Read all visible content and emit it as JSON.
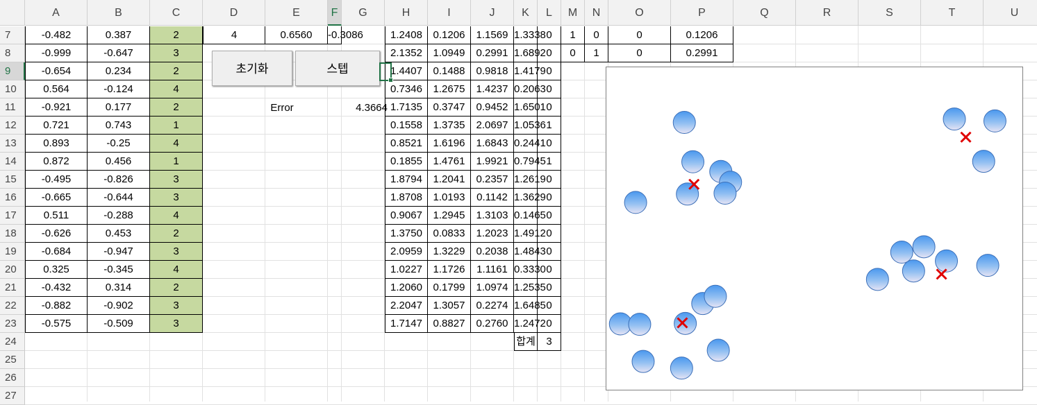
{
  "columns": [
    "A",
    "B",
    "C",
    "D",
    "E",
    "F",
    "G",
    "H",
    "I",
    "J",
    "K",
    "L",
    "M",
    "N",
    "O",
    "P",
    "Q",
    "R",
    "S",
    "T",
    "U"
  ],
  "rows": [
    "7",
    "8",
    "9",
    "10",
    "11",
    "12",
    "13",
    "14",
    "15",
    "16",
    "17",
    "18",
    "19",
    "20",
    "21",
    "22",
    "23",
    "24",
    "25",
    "26",
    "27"
  ],
  "selected_column": "F",
  "selected_row": "9",
  "table_abc": [
    [
      "-0.482",
      "0.387",
      "2"
    ],
    [
      "-0.999",
      "-0.647",
      "3"
    ],
    [
      "-0.654",
      "0.234",
      "2"
    ],
    [
      "0.564",
      "-0.124",
      "4"
    ],
    [
      "-0.921",
      "0.177",
      "2"
    ],
    [
      "0.721",
      "0.743",
      "1"
    ],
    [
      "0.893",
      "-0.25",
      "4"
    ],
    [
      "0.872",
      "0.456",
      "1"
    ],
    [
      "-0.495",
      "-0.826",
      "3"
    ],
    [
      "-0.665",
      "-0.644",
      "3"
    ],
    [
      "0.511",
      "-0.288",
      "4"
    ],
    [
      "-0.626",
      "0.453",
      "2"
    ],
    [
      "-0.684",
      "-0.947",
      "3"
    ],
    [
      "0.325",
      "-0.345",
      "4"
    ],
    [
      "-0.432",
      "0.314",
      "2"
    ],
    [
      "-0.882",
      "-0.902",
      "3"
    ],
    [
      "-0.575",
      "-0.509",
      "3"
    ]
  ],
  "table_def": [
    "4",
    "0.6560",
    "-0.3086"
  ],
  "buttons": {
    "init": "초기화",
    "step": "스텝"
  },
  "error": {
    "label": "Error",
    "value": "4.3664"
  },
  "table_hijkl": [
    [
      "1.2408",
      "0.1206",
      "1.1569",
      "1.3338",
      "0"
    ],
    [
      "2.1352",
      "1.0949",
      "0.2991",
      "1.6892",
      "0"
    ],
    [
      "1.4407",
      "0.1488",
      "0.9818",
      "1.4179",
      "0"
    ],
    [
      "0.7346",
      "1.2675",
      "1.4237",
      "0.2063",
      "0"
    ],
    [
      "1.7135",
      "0.3747",
      "0.9452",
      "1.6501",
      "0"
    ],
    [
      "0.1558",
      "1.3735",
      "2.0697",
      "1.0536",
      "1"
    ],
    [
      "0.8521",
      "1.6196",
      "1.6843",
      "0.2441",
      "0"
    ],
    [
      "0.1855",
      "1.4761",
      "1.9921",
      "0.7945",
      "1"
    ],
    [
      "1.8794",
      "1.2041",
      "0.2357",
      "1.2619",
      "0"
    ],
    [
      "1.8708",
      "1.0193",
      "0.1142",
      "1.3629",
      "0"
    ],
    [
      "0.9067",
      "1.2945",
      "1.3103",
      "0.1465",
      "0"
    ],
    [
      "1.3750",
      "0.0833",
      "1.2023",
      "1.4912",
      "0"
    ],
    [
      "2.0959",
      "1.3229",
      "0.2038",
      "1.4843",
      "0"
    ],
    [
      "1.0227",
      "1.1726",
      "1.1161",
      "0.3330",
      "0"
    ],
    [
      "1.2060",
      "0.1799",
      "1.0974",
      "1.2535",
      "0"
    ],
    [
      "2.2047",
      "1.3057",
      "0.2274",
      "1.6485",
      "0"
    ],
    [
      "1.7147",
      "0.8827",
      "0.2760",
      "1.2472",
      "0"
    ]
  ],
  "table_mnop": [
    [
      "1",
      "0",
      "0",
      "0.1206"
    ],
    [
      "0",
      "1",
      "0",
      "0.2991"
    ]
  ],
  "sum_row": {
    "label": "합계",
    "value": "3"
  },
  "colors": {
    "header_bg": "#f2f2f2",
    "green_cell": "#c6d9a0",
    "excel_green": "#217346",
    "marker": "#e00000"
  },
  "chart_data": {
    "type": "scatter",
    "xlim": [
      -1,
      1
    ],
    "ylim": [
      -1,
      1
    ],
    "grid": false,
    "series": [
      {
        "marker": "circle-gradient-blue",
        "points": [
          [
            -0.482,
            0.387
          ],
          [
            -0.999,
            -0.647
          ],
          [
            -0.654,
            0.234
          ],
          [
            0.564,
            -0.124
          ],
          [
            -0.921,
            0.177
          ],
          [
            0.721,
            0.743
          ],
          [
            0.893,
            -0.25
          ],
          [
            0.872,
            0.456
          ],
          [
            -0.495,
            -0.826
          ],
          [
            -0.665,
            -0.644
          ],
          [
            0.511,
            -0.288
          ],
          [
            -0.626,
            0.453
          ],
          [
            -0.684,
            -0.947
          ],
          [
            0.325,
            -0.345
          ],
          [
            -0.432,
            0.314
          ],
          [
            -0.882,
            -0.902
          ],
          [
            -0.575,
            -0.509
          ],
          [
            0.93,
            0.73
          ],
          [
            -0.67,
            0.72
          ],
          [
            -0.46,
            0.24
          ],
          [
            -0.51,
            -0.46
          ],
          [
            -0.9,
            -0.65
          ],
          [
            0.45,
            -0.16
          ],
          [
            0.68,
            -0.22
          ]
        ]
      },
      {
        "marker": "x-red",
        "points": [
          [
            -0.62,
            0.3
          ],
          [
            0.78,
            0.62
          ],
          [
            0.655,
            -0.31
          ],
          [
            -0.68,
            -0.64
          ]
        ]
      }
    ]
  }
}
